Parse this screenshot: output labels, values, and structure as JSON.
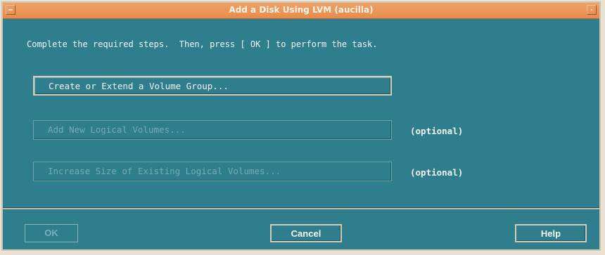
{
  "window": {
    "title": "Add a Disk Using LVM (aucilla)"
  },
  "instructions": "Complete the required steps.  Then, press [ OK ] to perform the task.",
  "steps": [
    {
      "label": "Create or Extend a Volume Group...",
      "enabled": true
    },
    {
      "label": "Add New Logical Volumes...",
      "enabled": false,
      "note": "(optional)"
    },
    {
      "label": "Increase Size of Existing Logical Volumes...",
      "enabled": false,
      "note": "(optional)"
    }
  ],
  "buttons": {
    "ok": "OK",
    "cancel": "Cancel",
    "help": "Help"
  },
  "colors": {
    "background": "#2f7e8e",
    "titlebar": "#e88c4c",
    "text": "#f2f2f2",
    "disabled_text": "#78aab4"
  }
}
